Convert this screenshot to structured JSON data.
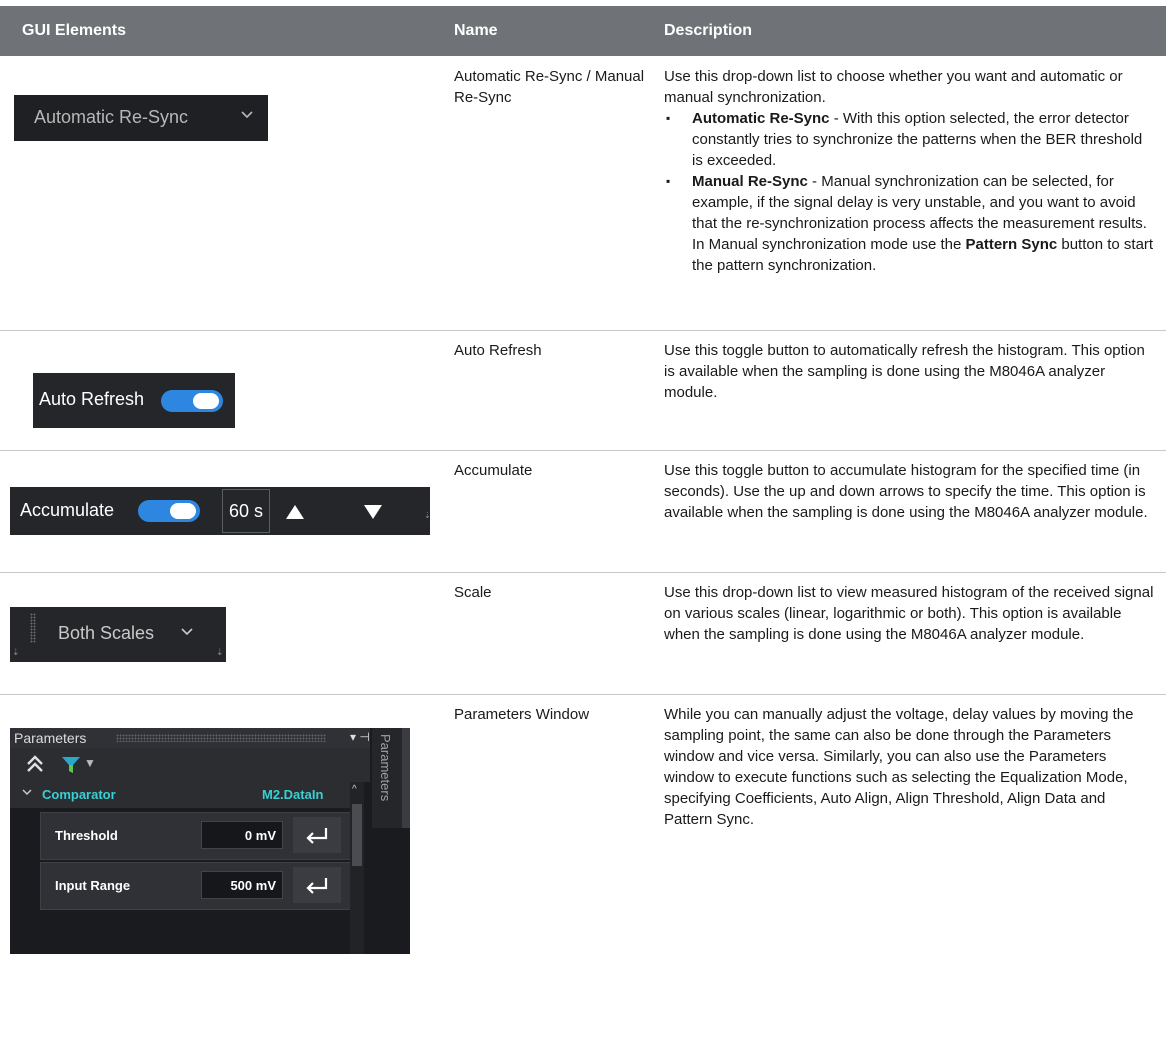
{
  "header": {
    "col_gui": "GUI Elements",
    "col_name": "Name",
    "col_desc": "Description"
  },
  "rows": [
    {
      "name": "Automatic Re-Sync / Manual Re-Sync",
      "widget": {
        "label": "Automatic  Re-Sync",
        "chevron": "chevron-down-icon"
      },
      "desc_intro": "Use this drop-down list to choose whether you want and automatic or manual synchronization.",
      "bullets": [
        {
          "bold": "Automatic Re-Sync",
          "text": " - With this option selected, the error detector constantly tries to synchronize the patterns when the BER threshold is exceeded."
        },
        {
          "bold": "Manual Re-Sync",
          "text": " - Manual synchronization can be selected, for example, if the signal delay is very unstable, and you want to avoid that the re-synchronization process affects the measurement results. In Manual synchronization mode use the ",
          "bold2": "Pattern Sync",
          "text2": " button to start the pattern synchronization."
        }
      ]
    },
    {
      "name": "Auto Refresh",
      "widget": {
        "label": "Auto Refresh",
        "toggle_on": true,
        "toggle_color": "#2d87e0"
      },
      "desc": "Use this toggle button to automatically refresh the histogram. This option is available when the sampling is done using the M8046A analyzer module."
    },
    {
      "name": "Accumulate",
      "widget": {
        "label": "Accumulate",
        "toggle_on": true,
        "time_value": "60 s",
        "up_icon": "triangle-up-icon",
        "down_icon": "triangle-down-icon"
      },
      "desc": "Use this toggle button to accumulate histogram for the specified time (in seconds). Use the up and down arrows to specify the time. This option is available when the sampling is done using the M8046A analyzer module."
    },
    {
      "name": "Scale",
      "widget": {
        "label": "Both Scales",
        "chevron": "chevron-down-icon"
      },
      "desc": "Use this drop-down list to view measured histogram of the received signal on various scales (linear, logarithmic or both). This option is available when the sampling is done using the M8046A analyzer module."
    },
    {
      "name": "Parameters Window",
      "widget": {
        "title": "Parameters",
        "side_tab": "Parameters",
        "section": "Comparator",
        "section_id": "M2.DataIn",
        "params": [
          {
            "label": "Threshold",
            "value": "0 mV"
          },
          {
            "label": "Input Range",
            "value": "500 mV"
          }
        ],
        "accent": "#38d0d4"
      },
      "desc": "While you can manually adjust the voltage, delay values by moving the sampling point, the same can also be done through the Parameters window and vice versa. Similarly, you can also use the Parameters window to execute functions such as selecting the Equalization Mode, specifying Coefficients, Auto Align, Align Threshold, Align Data and Pattern Sync."
    }
  ]
}
